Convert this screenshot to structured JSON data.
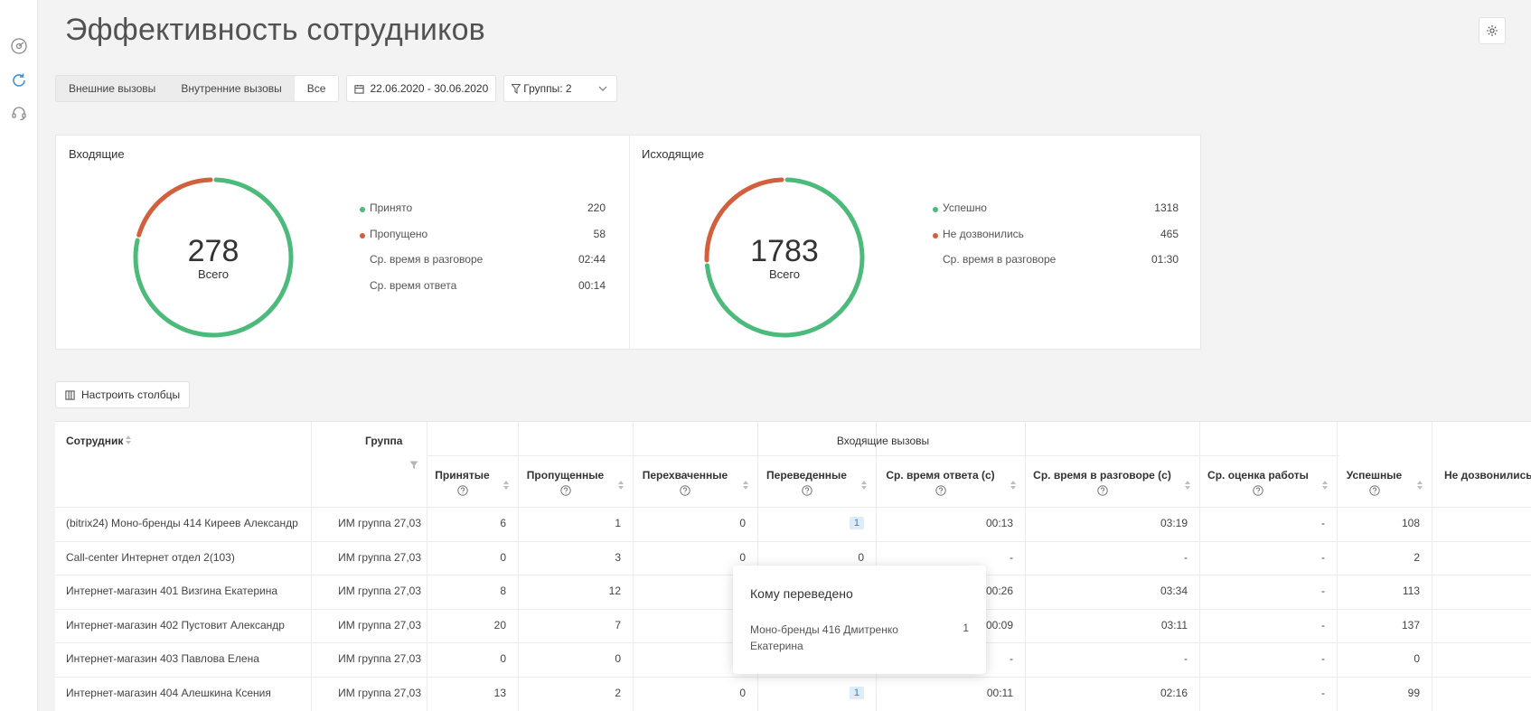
{
  "page": {
    "title": "Эффективность сотрудников"
  },
  "sidebar": {
    "icons": [
      "dashboard-icon",
      "refresh-icon",
      "headset-icon"
    ]
  },
  "toolbar": {
    "tabs": [
      {
        "label": "Внешние вызовы",
        "active": false
      },
      {
        "label": "Внутренние вызовы",
        "active": false
      },
      {
        "label": "Все",
        "active": true
      }
    ],
    "date_range": "22.06.2020 - 30.06.2020",
    "groups_filter": "Группы: 2"
  },
  "incoming": {
    "title": "Входящие",
    "total": "278",
    "total_label": "Всего",
    "accepted_fraction": 0.791,
    "legend": [
      {
        "label": "Принято",
        "value": "220",
        "color": "#4cba7a"
      },
      {
        "label": "Пропущено",
        "value": "58",
        "color": "#d2603d"
      },
      {
        "label": "Ср. время в разговоре",
        "value": "02:44"
      },
      {
        "label": "Ср. время ответа",
        "value": "00:14"
      }
    ]
  },
  "outgoing": {
    "title": "Исходящие",
    "total": "1783",
    "total_label": "Всего",
    "accepted_fraction": 0.739,
    "legend": [
      {
        "label": "Успешно",
        "value": "1318",
        "color": "#4cba7a"
      },
      {
        "label": "Не дозвонились",
        "value": "465",
        "color": "#d2603d"
      },
      {
        "label": "Ср. время в разговоре",
        "value": "01:30"
      }
    ]
  },
  "columns_button": "Настроить столбцы",
  "table": {
    "col_employee": "Сотрудник",
    "col_group": "Группа",
    "group_incoming": "Входящие вызовы",
    "columns": [
      "Принятые",
      "Пропущенные",
      "Перехваченные",
      "Переведенные",
      "Ср. время ответа (с)",
      "Ср. время в разговоре (с)",
      "Ср. оценка работы",
      "Успешные",
      "Не дозвонились"
    ],
    "rows": [
      {
        "employee": "(bitrix24) Моно-бренды 414 Киреев Александр",
        "group": "ИМ группа 27,03",
        "accepted": "6",
        "missed": "1",
        "intercepted": "0",
        "transferred": "1",
        "avg_answer": "00:13",
        "avg_talk": "03:19",
        "rating": "-",
        "successful": "108"
      },
      {
        "employee": "Call-center Интернет отдел 2(103)",
        "group": "ИМ группа 27,03",
        "accepted": "0",
        "missed": "3",
        "intercepted": "0",
        "transferred": "0",
        "avg_answer": "-",
        "avg_talk": "-",
        "rating": "-",
        "successful": "2"
      },
      {
        "employee": "Интернет-магазин 401 Визгина Екатерина",
        "group": "ИМ группа 27,03",
        "accepted": "8",
        "missed": "12",
        "intercepted": "",
        "transferred": "",
        "avg_answer": "00:26",
        "avg_talk": "03:34",
        "rating": "-",
        "successful": "113"
      },
      {
        "employee": "Интернет-магазин 402 Пустовит Александр",
        "group": "ИМ группа 27,03",
        "accepted": "20",
        "missed": "7",
        "intercepted": "",
        "transferred": "",
        "avg_answer": "00:09",
        "avg_talk": "03:11",
        "rating": "-",
        "successful": "137"
      },
      {
        "employee": "Интернет-магазин 403 Павлова Елена",
        "group": "ИМ группа 27,03",
        "accepted": "0",
        "missed": "0",
        "intercepted": "",
        "transferred": "",
        "avg_answer": "-",
        "avg_talk": "-",
        "rating": "-",
        "successful": "0"
      },
      {
        "employee": "Интернет-магазин 404 Алешкина Ксения",
        "group": "ИМ группа 27,03",
        "accepted": "13",
        "missed": "2",
        "intercepted": "0",
        "transferred": "1",
        "avg_answer": "00:11",
        "avg_talk": "02:16",
        "rating": "-",
        "successful": "99"
      }
    ]
  },
  "popover": {
    "title": "Кому переведено",
    "item": "Моно-бренды 416 Дмитренко Екатерина",
    "count": "1"
  }
}
